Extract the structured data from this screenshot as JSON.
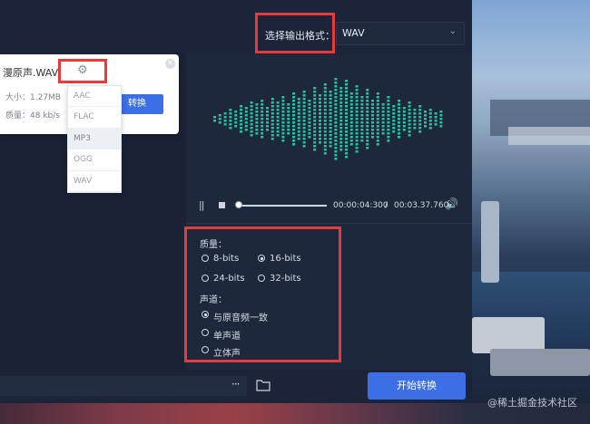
{
  "header": {
    "output_format_label": "选择输出格式：",
    "output_format_value": "WAV"
  },
  "file_card": {
    "name": "漫原声.WAV",
    "size": "大小：1.27MB",
    "quality": "质量：48 kb/s",
    "convert_label": "转换",
    "close_glyph": "×",
    "gear_glyph": "⚙"
  },
  "format_dropdown": {
    "options": [
      "AAC",
      "FLAC",
      "MP3",
      "OGG",
      "WAV"
    ],
    "selected": "MP3"
  },
  "player": {
    "current_time": "00:00:04:300",
    "separator": "/",
    "total_time": "00:03.37.760",
    "progress": 0.0,
    "pause_glyph": "||",
    "volume_glyph": "🔊"
  },
  "settings": {
    "quality_label": "质量：",
    "quality_options": [
      "8-bits",
      "16-bits",
      "24-bits",
      "32-bits"
    ],
    "quality_selected": "16-bits",
    "channel_label": "声道：",
    "channel_options": [
      "与原音频一致",
      "单声道",
      "立体声"
    ],
    "channel_selected": "与原音频一致"
  },
  "bottom": {
    "more_glyph": "···",
    "start_label": "开始转换",
    "watermark": "@稀土掘金技术社区"
  },
  "colors": {
    "accent": "#3c6ee6",
    "waveform": "#27c3a0",
    "highlight": "#e83a3a"
  }
}
